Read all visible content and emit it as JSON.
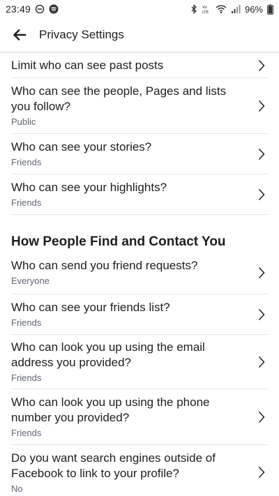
{
  "status_bar": {
    "time": "23:49",
    "battery": "96%",
    "left_icons": [
      "do-not-disturb-icon",
      "spotify-icon"
    ],
    "right_icons": [
      "bluetooth-icon",
      "volte-icon",
      "wifi-icon",
      "signal-icon",
      "battery-icon"
    ]
  },
  "header": {
    "title": "Privacy Settings",
    "back_icon": "arrow-left-icon"
  },
  "rows_top": [
    {
      "title": "Limit who can see past posts",
      "sub": ""
    },
    {
      "title": "Who can see the people, Pages and lists you follow?",
      "sub": "Public"
    },
    {
      "title": "Who can see your stories?",
      "sub": "Friends"
    },
    {
      "title": "Who can see your highlights?",
      "sub": "Friends"
    }
  ],
  "section": {
    "title": "How People Find and Contact You"
  },
  "rows_section": [
    {
      "title": "Who can send you friend requests?",
      "sub": "Everyone"
    },
    {
      "title": "Who can see your friends list?",
      "sub": "Friends"
    },
    {
      "title": "Who can look you up using the email address you provided?",
      "sub": "Friends"
    },
    {
      "title": "Who can look you up using the phone number you provided?",
      "sub": "Friends"
    },
    {
      "title": "Do you want search engines outside of Facebook to link to your profile?",
      "sub": "No"
    }
  ],
  "colors": {
    "text_primary": "#1c1e21",
    "text_secondary": "#606770",
    "divider": "#e4e6ea"
  }
}
